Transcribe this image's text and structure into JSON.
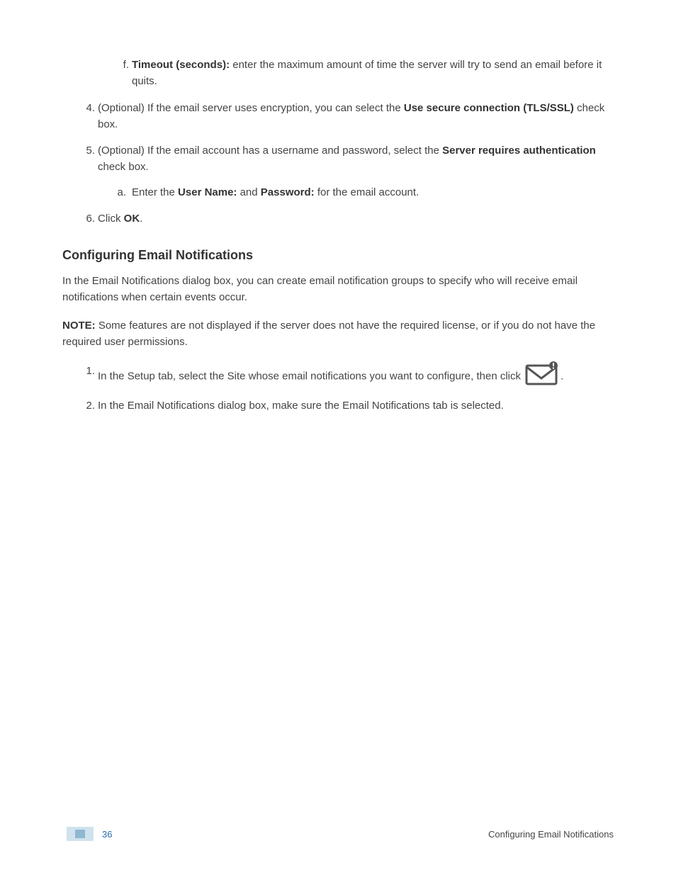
{
  "list_f": {
    "marker": "f.",
    "bold": "Timeout (seconds):",
    "rest": " enter the maximum amount of time the server will try to send an email before it quits."
  },
  "item4": {
    "marker": "4.",
    "pre": "(Optional) If the email server uses encryption, you can select the ",
    "bold": "Use secure connection (TLS/SSL)",
    "post": " check box."
  },
  "item5": {
    "marker": "5.",
    "pre": "(Optional) If the email account has a username and password, select the ",
    "bold": "Server requires authentication",
    "post": " check box.",
    "sub_a": {
      "marker": "a.",
      "pre": "Enter the ",
      "bold1": "User Name:",
      "mid": " and ",
      "bold2": "Password:",
      "post": " for the email account."
    }
  },
  "item6": {
    "marker": "6.",
    "pre": "Click ",
    "bold": "OK",
    "post": "."
  },
  "heading": "Configuring Email Notifications",
  "para1": "In the Email Notifications dialog box, you can create email notification groups to specify who will receive email notifications when certain events occur.",
  "para2": {
    "bold": "NOTE:",
    "rest": " Some features are not displayed if the server does not have the required license, or if you do not have the required user permissions."
  },
  "steps": {
    "s1": {
      "marker": "1.",
      "pre": "In the Setup tab, select the Site whose email notifications you want to configure, then click ",
      "post": "."
    },
    "s2": {
      "marker": "2.",
      "text": "In the Email Notifications dialog box, make sure the Email Notifications tab is selected."
    }
  },
  "footer": {
    "page": "36",
    "title": "Configuring Email Notifications"
  }
}
